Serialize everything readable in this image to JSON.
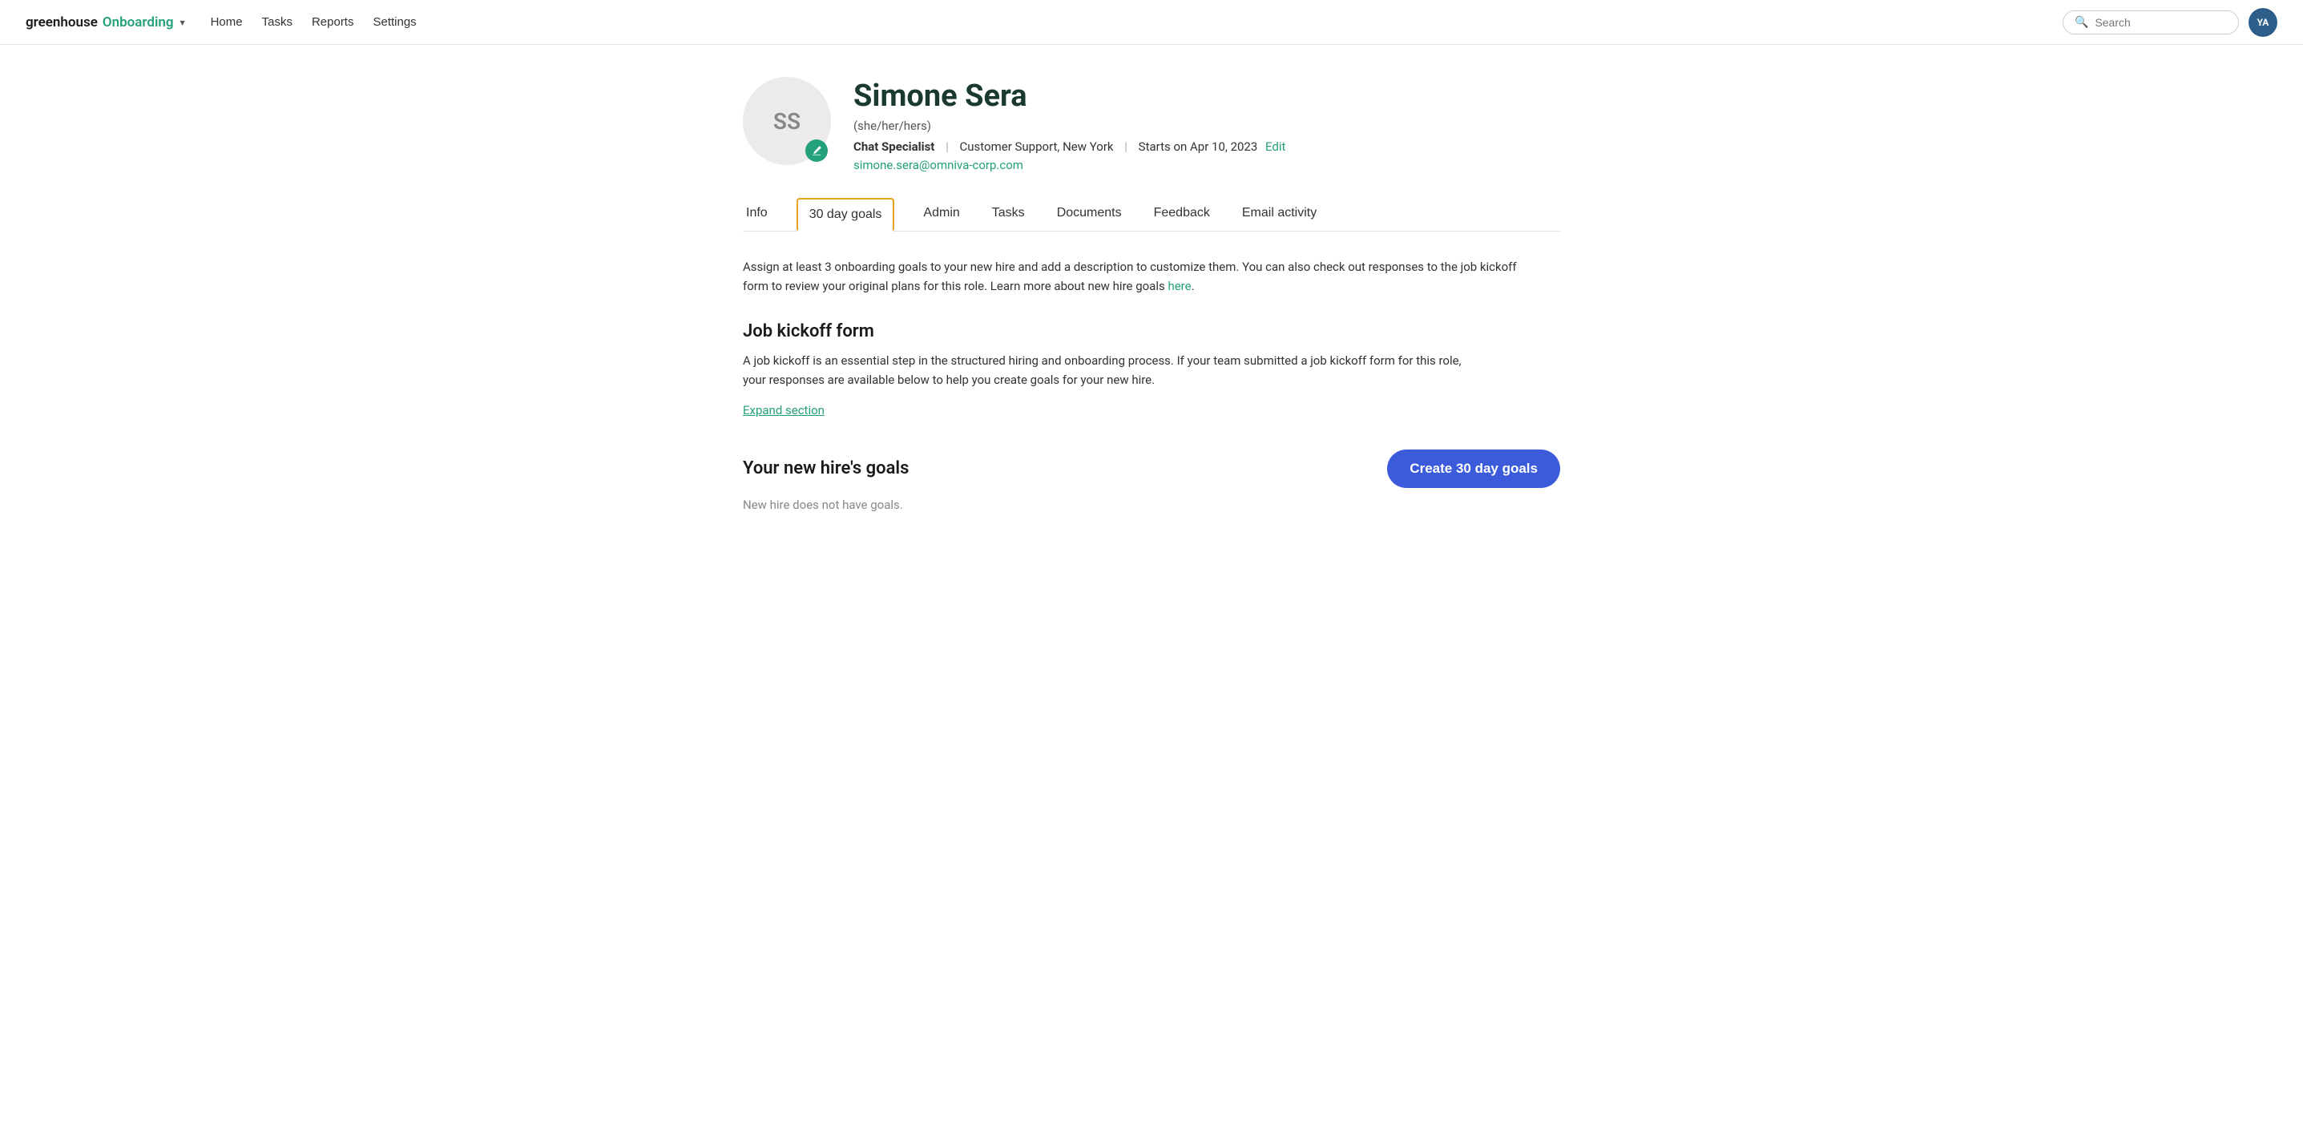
{
  "nav": {
    "brand_greenhouse": "greenhouse",
    "brand_onboarding": "Onboarding",
    "links": [
      {
        "label": "Home",
        "name": "home"
      },
      {
        "label": "Tasks",
        "name": "tasks"
      },
      {
        "label": "Reports",
        "name": "reports"
      },
      {
        "label": "Settings",
        "name": "settings"
      }
    ],
    "search_placeholder": "Search",
    "avatar_initials": "YA"
  },
  "profile": {
    "initials": "SS",
    "name": "Simone Sera",
    "pronouns": "(she/her/hers)",
    "job_title": "Chat Specialist",
    "department": "Customer Support, New York",
    "start_date": "Starts on Apr 10, 2023",
    "edit_label": "Edit",
    "email": "simone.sera@omniva-corp.com"
  },
  "tabs": [
    {
      "label": "Info",
      "name": "info",
      "active": false
    },
    {
      "label": "30 day goals",
      "name": "30-day-goals",
      "active": true
    },
    {
      "label": "Admin",
      "name": "admin",
      "active": false
    },
    {
      "label": "Tasks",
      "name": "tasks",
      "active": false
    },
    {
      "label": "Documents",
      "name": "documents",
      "active": false
    },
    {
      "label": "Feedback",
      "name": "feedback",
      "active": false
    },
    {
      "label": "Email activity",
      "name": "email-activity",
      "active": false
    }
  ],
  "content": {
    "description": "Assign at least 3 onboarding goals to your new hire and add a description to customize them. You can also check out responses to the job kickoff form to review your original plans for this role. Learn more about new hire goals",
    "description_link_text": "here",
    "kickoff_heading": "Job kickoff form",
    "kickoff_body": "A job kickoff is an essential step in the structured hiring and onboarding process. If your team submitted a job kickoff form for this role, your responses are available below to help you create goals for your new hire.",
    "expand_label": "Expand section",
    "goals_heading": "Your new hire's goals",
    "create_button_label": "Create 30 day goals",
    "no_goals_text": "New hire does not have goals."
  }
}
